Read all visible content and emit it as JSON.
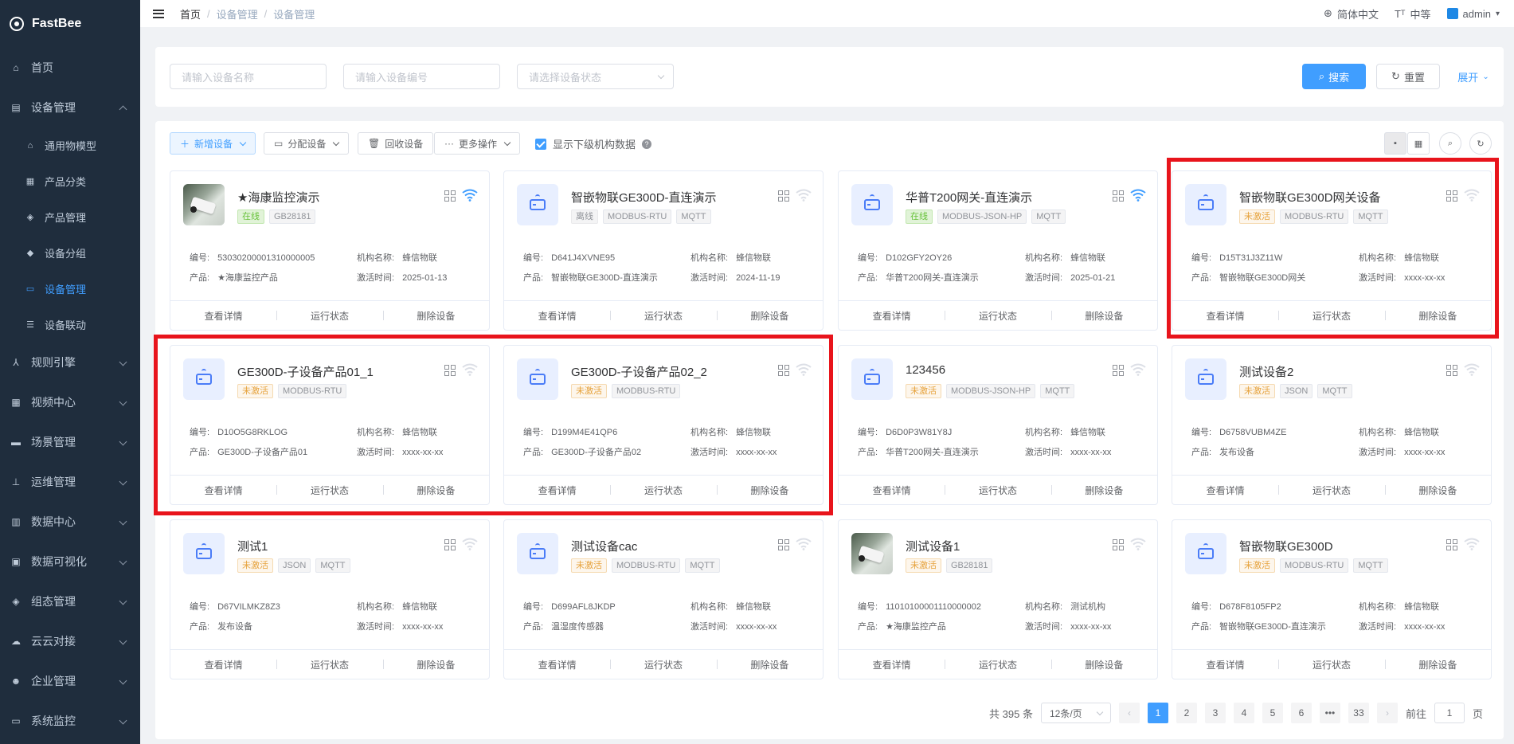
{
  "app": {
    "title": "FastBee"
  },
  "sidebar": {
    "items": [
      {
        "label": "首页",
        "icon": "home-icon"
      },
      {
        "label": "设备管理",
        "icon": "device-icon",
        "expanded": true
      },
      {
        "label": "规则引擎",
        "icon": "rule-icon"
      },
      {
        "label": "视频中心",
        "icon": "video-icon"
      },
      {
        "label": "场景管理",
        "icon": "scene-icon"
      },
      {
        "label": "运维管理",
        "icon": "ops-icon"
      },
      {
        "label": "数据中心",
        "icon": "data-icon"
      },
      {
        "label": "数据可视化",
        "icon": "visual-icon"
      },
      {
        "label": "组态管理",
        "icon": "config-icon"
      },
      {
        "label": "云云对接",
        "icon": "cloud-icon"
      },
      {
        "label": "企业管理",
        "icon": "enterprise-icon"
      },
      {
        "label": "系统监控",
        "icon": "monitor-icon"
      }
    ],
    "sub_items": [
      {
        "label": "通用物模型"
      },
      {
        "label": "产品分类"
      },
      {
        "label": "产品管理"
      },
      {
        "label": "设备分组"
      },
      {
        "label": "设备管理",
        "active": true
      },
      {
        "label": "设备联动"
      }
    ]
  },
  "topbar": {
    "breadcrumb": [
      "首页",
      "设备管理",
      "设备管理"
    ],
    "language": "简体中文",
    "size": "中等",
    "user": "admin"
  },
  "search": {
    "name_placeholder": "请输入设备名称",
    "serial_placeholder": "请输入设备编号",
    "status_placeholder": "请选择设备状态",
    "search_label": "搜索",
    "reset_label": "重置",
    "expand_label": "展开"
  },
  "toolbar": {
    "add_label": "新增设备",
    "assign_label": "分配设备",
    "recycle_label": "回收设备",
    "more_label": "更多操作",
    "show_sub_org_label": "显示下级机构数据",
    "show_sub_org_checked": true
  },
  "labels": {
    "serial": "编号:",
    "product": "产品:",
    "org": "机构名称:",
    "activated": "激活时间:",
    "view_detail": "查看详情",
    "run_status": "运行状态",
    "delete": "删除设备"
  },
  "devices": [
    {
      "name": "★海康监控演示",
      "image": "camera",
      "status": "在线",
      "status_type": "online",
      "tags": [
        "GB28181"
      ],
      "serial": "53030200001310000005",
      "product": "★海康监控产品",
      "org": "蜂信物联",
      "activated": "2025-01-13",
      "wifi": "active"
    },
    {
      "name": "智嵌物联GE300D-直连演示",
      "image": "router",
      "status": "离线",
      "status_type": "offline",
      "tags": [
        "MODBUS-RTU",
        "MQTT"
      ],
      "serial": "D641J4XVNE95",
      "product": "智嵌物联GE300D-直连演示",
      "org": "蜂信物联",
      "activated": "2024-11-19",
      "wifi": "inactive"
    },
    {
      "name": "华普T200网关-直连演示",
      "image": "router",
      "status": "在线",
      "status_type": "online",
      "tags": [
        "MODBUS-JSON-HP",
        "MQTT"
      ],
      "serial": "D102GFY2OY26",
      "product": "华普T200网关-直连演示",
      "org": "蜂信物联",
      "activated": "2025-01-21",
      "wifi": "active"
    },
    {
      "name": "智嵌物联GE300D网关设备",
      "image": "router",
      "status": "未激活",
      "status_type": "inactive",
      "tags": [
        "MODBUS-RTU",
        "MQTT"
      ],
      "serial": "D15T31J3Z11W",
      "product": "智嵌物联GE300D网关",
      "org": "蜂信物联",
      "activated": "xxxx-xx-xx",
      "wifi": "inactive"
    },
    {
      "name": "GE300D-子设备产品01_1",
      "image": "router",
      "status": "未激活",
      "status_type": "inactive",
      "tags": [
        "MODBUS-RTU"
      ],
      "serial": "D10O5G8RKLOG",
      "product": "GE300D-子设备产品01",
      "org": "蜂信物联",
      "activated": "xxxx-xx-xx",
      "wifi": "inactive"
    },
    {
      "name": "GE300D-子设备产品02_2",
      "image": "router",
      "status": "未激活",
      "status_type": "inactive",
      "tags": [
        "MODBUS-RTU"
      ],
      "serial": "D199M4E41QP6",
      "product": "GE300D-子设备产品02",
      "org": "蜂信物联",
      "activated": "xxxx-xx-xx",
      "wifi": "inactive"
    },
    {
      "name": "123456",
      "image": "router",
      "status": "未激活",
      "status_type": "inactive",
      "tags": [
        "MODBUS-JSON-HP",
        "MQTT"
      ],
      "serial": "D6D0P3W81Y8J",
      "product": "华普T200网关-直连演示",
      "org": "蜂信物联",
      "activated": "xxxx-xx-xx",
      "wifi": "inactive"
    },
    {
      "name": "测试设备2",
      "image": "router",
      "status": "未激活",
      "status_type": "inactive",
      "tags": [
        "JSON",
        "MQTT"
      ],
      "serial": "D6758VUBM4ZE",
      "product": "发布设备",
      "org": "蜂信物联",
      "activated": "xxxx-xx-xx",
      "wifi": "inactive"
    },
    {
      "name": "测试1",
      "image": "router",
      "status": "未激活",
      "status_type": "inactive",
      "tags": [
        "JSON",
        "MQTT"
      ],
      "serial": "D67VILMKZ8Z3",
      "product": "发布设备",
      "org": "蜂信物联",
      "activated": "xxxx-xx-xx",
      "wifi": "inactive"
    },
    {
      "name": "测试设备cac",
      "image": "router",
      "status": "未激活",
      "status_type": "inactive",
      "tags": [
        "MODBUS-RTU",
        "MQTT"
      ],
      "serial": "D699AFL8JKDP",
      "product": "温湿度传感器",
      "org": "蜂信物联",
      "activated": "xxxx-xx-xx",
      "wifi": "inactive"
    },
    {
      "name": "测试设备1",
      "image": "camera",
      "status": "未激活",
      "status_type": "inactive",
      "tags": [
        "GB28181"
      ],
      "serial": "11010100001110000002",
      "product": "★海康监控产品",
      "org": "测试机构",
      "activated": "xxxx-xx-xx",
      "wifi": "inactive"
    },
    {
      "name": "智嵌物联GE300D",
      "image": "router",
      "status": "未激活",
      "status_type": "inactive",
      "tags": [
        "MODBUS-RTU",
        "MQTT"
      ],
      "serial": "D678F8105FP2",
      "product": "智嵌物联GE300D-直连演示",
      "org": "蜂信物联",
      "activated": "xxxx-xx-xx",
      "wifi": "inactive"
    }
  ],
  "pagination": {
    "total_text": "共 395 条",
    "page_size": "12条/页",
    "pages": [
      "1",
      "2",
      "3",
      "4",
      "5",
      "6",
      "•••",
      "33"
    ],
    "current": "1",
    "goto_label": "前往",
    "goto_value": "1",
    "page_suffix": "页"
  },
  "colors": {
    "primary": "#409eff",
    "sidebar_bg": "#1f2d3d",
    "highlight": "#e8141c",
    "online": "#67c23a",
    "inactive": "#e6a23c"
  }
}
